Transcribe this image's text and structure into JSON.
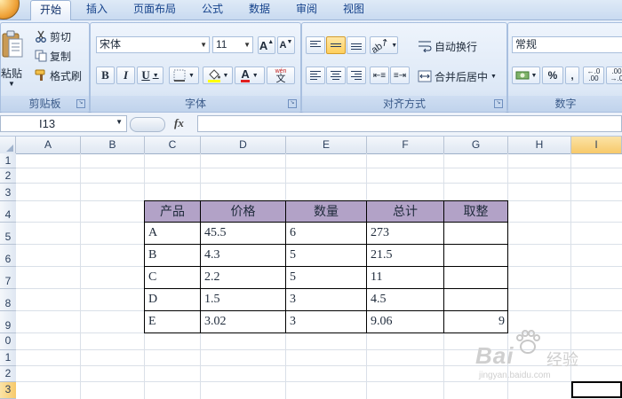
{
  "tabs": [
    "开始",
    "插入",
    "页面布局",
    "公式",
    "数据",
    "审阅",
    "视图"
  ],
  "active_tab": "开始",
  "clipboard": {
    "paste": "粘贴",
    "cut": "剪切",
    "copy": "复制",
    "format_painter": "格式刷",
    "group_label": "剪贴板"
  },
  "font": {
    "name": "宋体",
    "size": "11",
    "grow": "A",
    "shrink": "A",
    "bold": "B",
    "italic": "I",
    "underline": "U",
    "font_color_letter": "A",
    "phonetic_top": "wén",
    "phonetic_char": "文",
    "group_label": "字体"
  },
  "alignment": {
    "wrap_text": "自动换行",
    "merge_center": "合并后居中",
    "group_label": "对齐方式"
  },
  "number": {
    "format": "常规",
    "percent": "%",
    "comma": ",",
    "inc_decimal": "←.0\n.00",
    "dec_decimal": ".00\n→.0",
    "group_label": "数字"
  },
  "formula_bar": {
    "name_box": "I13",
    "fx": "fx",
    "content": ""
  },
  "columns": [
    "A",
    "B",
    "C",
    "D",
    "E",
    "F",
    "G",
    "H",
    "I"
  ],
  "selected_column": "I",
  "rows": [
    "1",
    "2",
    "3",
    "4",
    "5",
    "6",
    "7",
    "8",
    "9",
    "0",
    "1",
    "2",
    "3"
  ],
  "table": {
    "headers": [
      "产品",
      "价格",
      "数量",
      "总计",
      "取整"
    ],
    "rows": [
      [
        "A",
        "45.5",
        "6",
        "273",
        ""
      ],
      [
        "B",
        "4.3",
        "5",
        "21.5",
        ""
      ],
      [
        "C",
        "2.2",
        "5",
        "11",
        ""
      ],
      [
        "D",
        "1.5",
        "3",
        "4.5",
        ""
      ],
      [
        "E",
        "3.02",
        "3",
        "9.06",
        "9"
      ]
    ]
  },
  "watermark": {
    "brand": "Bai",
    "brand_cn": "经验",
    "url": "jingyan.baidu.com"
  },
  "colors": {
    "header_fill": "#b2a2c7",
    "ribbon": "#dbe7f6",
    "selected_col": "#f7c96a"
  }
}
